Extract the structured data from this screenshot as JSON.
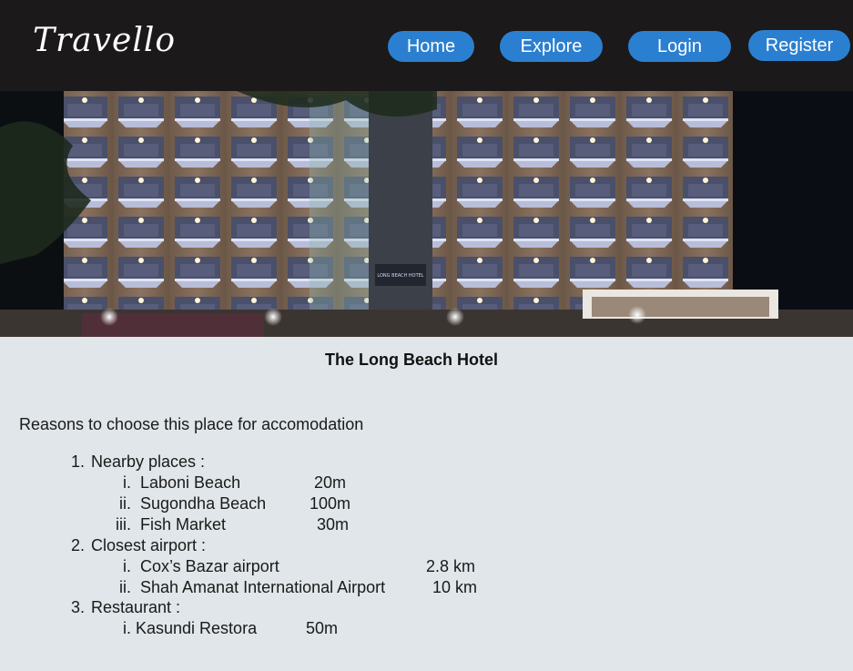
{
  "header": {
    "logo": "Travello",
    "nav": {
      "home": "Home",
      "explore": "Explore",
      "login": "Login",
      "register": "Register"
    },
    "accent_color": "#2b7fd0",
    "background_color": "#1b1919"
  },
  "hero": {
    "image_description_icon": "hotel-photo",
    "sign_text": "LONG BEACH HOTEL"
  },
  "main": {
    "title": "The Long Beach Hotel",
    "intro": "Reasons to choose this place for accomodation",
    "sections": [
      {
        "number": "1.",
        "label": "Nearby places :",
        "items": [
          {
            "marker": "i.",
            "name": "Laboni Beach",
            "value": "20m"
          },
          {
            "marker": "ii.",
            "name": "Sugondha Beach",
            "value": "100m"
          },
          {
            "marker": "iii.",
            "name": "Fish Market",
            "value": "30m"
          }
        ]
      },
      {
        "number": "2.",
        "label": "Closest airport :",
        "items": [
          {
            "marker": "i.",
            "name": "Cox’s Bazar airport",
            "value": "2.8 km"
          },
          {
            "marker": "ii.",
            "name": "Shah Amanat International Airport",
            "value": "10 km"
          }
        ]
      },
      {
        "number": "3.",
        "label": "Restaurant :",
        "items": [
          {
            "marker": "i.",
            "name": "Kasundi Restora",
            "value": "50m"
          }
        ]
      }
    ]
  }
}
